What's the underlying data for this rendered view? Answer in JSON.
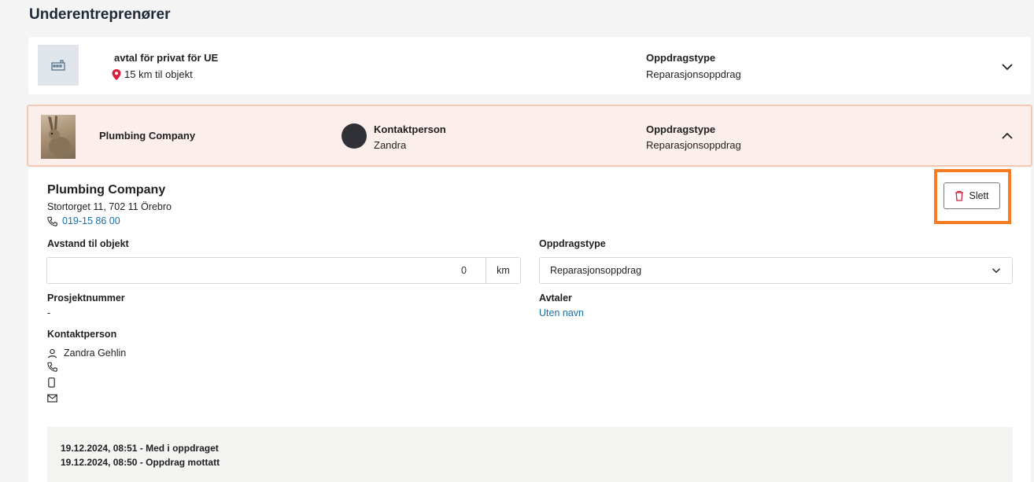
{
  "page_title": "Underentreprenører",
  "subcontractors": [
    {
      "name": "avtal för privat för UE",
      "distance_text": "15 km til objekt",
      "assignment_type_label": "Oppdragstype",
      "assignment_type_value": "Reparasjonsoppdrag"
    },
    {
      "name": "Plumbing Company",
      "contact_label": "Kontaktperson",
      "contact_value": "Zandra",
      "assignment_type_label": "Oppdragstype",
      "assignment_type_value": "Reparasjonsoppdrag"
    }
  ],
  "detail": {
    "company_name": "Plumbing Company",
    "address": "Stortorget 11, 702 11 Örebro",
    "phone": "019-15 86 00",
    "delete_label": "Slett",
    "distance_label": "Avstand til objekt",
    "distance_value": "0",
    "distance_unit": "km",
    "assignment_type_label": "Oppdragstype",
    "assignment_type_selected": "Reparasjonsoppdrag",
    "project_number_label": "Prosjektnummer",
    "project_number_value": "-",
    "agreements_label": "Avtaler",
    "agreements_link": "Uten navn",
    "contact_person_label": "Kontaktperson",
    "contact_person_name": "Zandra Gehlin",
    "log": [
      "19.12.2024, 08:51 - Med i oppdraget",
      "19.12.2024, 08:50 - Oppdrag mottatt"
    ]
  },
  "colors": {
    "highlight_bg": "#fceeea",
    "highlight_border": "#f3c9b5",
    "annotation_orange": "#f57c22",
    "link_blue": "#1a6ea8",
    "danger_red": "#d6203a"
  },
  "icons": [
    "building-icon",
    "location-pin-icon",
    "chevron-down-icon",
    "chevron-up-icon",
    "trash-icon",
    "phone-icon",
    "person-icon",
    "mobile-icon",
    "mail-icon"
  ]
}
